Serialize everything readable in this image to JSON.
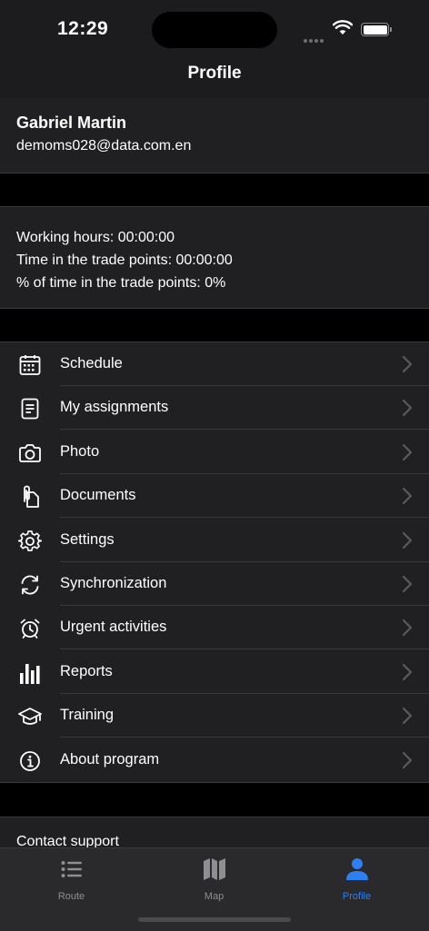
{
  "status": {
    "time": "12:29"
  },
  "nav": {
    "title": "Profile"
  },
  "user": {
    "name": "Gabriel Martin",
    "email": "demoms028@data.com.en"
  },
  "stats": {
    "working_hours": "Working hours: 00:00:00",
    "time_trade_points": "Time in the trade points: 00:00:00",
    "percent_trade_points": "% of time in the trade points: 0%"
  },
  "menu": [
    {
      "label": "Schedule",
      "icon": "calendar-icon"
    },
    {
      "label": "My assignments",
      "icon": "document-list-icon"
    },
    {
      "label": "Photo",
      "icon": "camera-icon"
    },
    {
      "label": "Documents",
      "icon": "documents-icon"
    },
    {
      "label": "Settings",
      "icon": "gear-icon"
    },
    {
      "label": "Synchronization",
      "icon": "sync-icon"
    },
    {
      "label": "Urgent activities",
      "icon": "alarm-clock-icon"
    },
    {
      "label": "Reports",
      "icon": "bar-chart-icon"
    },
    {
      "label": "Training",
      "icon": "graduation-cap-icon"
    },
    {
      "label": "About program",
      "icon": "info-icon"
    }
  ],
  "support": {
    "label": "Contact support"
  },
  "tabs": [
    {
      "label": "Route",
      "icon": "list-icon",
      "active": false
    },
    {
      "label": "Map",
      "icon": "map-icon",
      "active": false
    },
    {
      "label": "Profile",
      "icon": "person-icon",
      "active": true
    }
  ],
  "colors": {
    "accent": "#2f7ff1",
    "inactive": "#8e8e93",
    "background": "#1c1c1e"
  }
}
